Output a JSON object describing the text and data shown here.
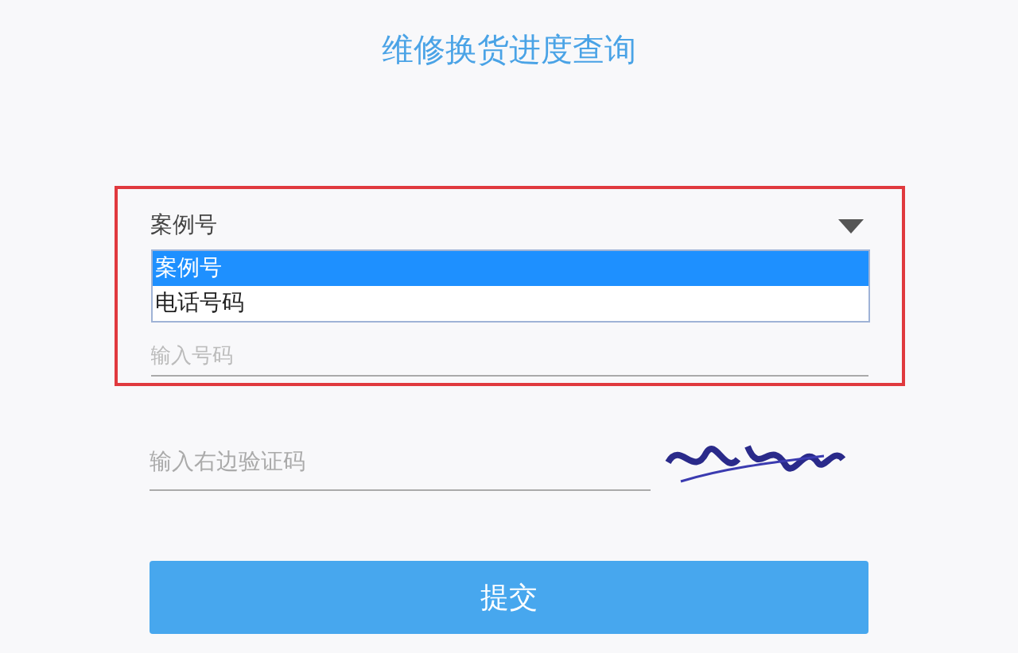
{
  "title": "维修换货进度查询",
  "query_type": {
    "value": "案例号",
    "expanded": true,
    "options": [
      {
        "label": "案例号",
        "selected": true
      },
      {
        "label": "电话号码",
        "selected": false
      }
    ]
  },
  "number_field": {
    "placeholder": "输入号码"
  },
  "captcha_field": {
    "placeholder": "输入右边验证码"
  },
  "submit_button": "提交"
}
